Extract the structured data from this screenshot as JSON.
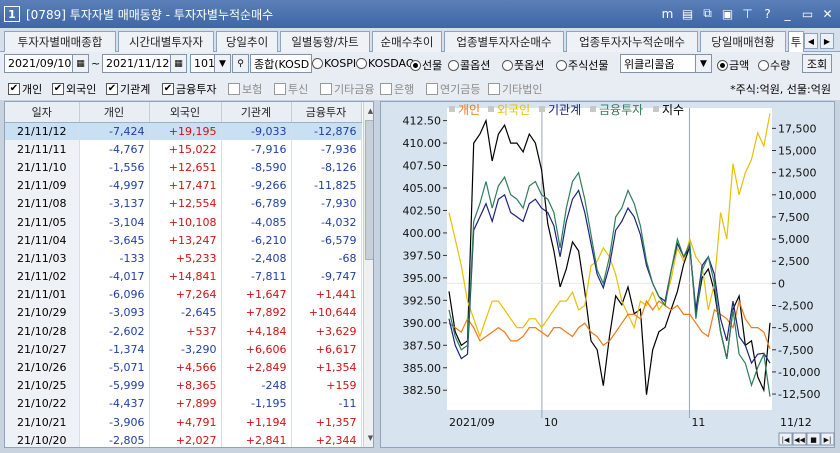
{
  "window": {
    "number": "1",
    "title": "[0789] 투자자별 매매동향 - 투자자별누적순매수",
    "icons": [
      "m-icon",
      "save-icon",
      "copy-icon",
      "window-icon",
      "pin-icon",
      "help-icon",
      "minimize-icon",
      "restore-icon",
      "close-icon"
    ],
    "icon_glyphs": [
      "m",
      "▤",
      "⧉",
      "▣",
      "⊤",
      "?",
      "_",
      "▭",
      "✕"
    ]
  },
  "tabs": [
    {
      "label": "투자자별매매종합",
      "active": false
    },
    {
      "label": "시간대별투자자",
      "active": false
    },
    {
      "label": "당일추이",
      "active": false
    },
    {
      "label": "일별동향/차트",
      "active": false
    },
    {
      "label": "순매수추이",
      "active": false
    },
    {
      "label": "업종별투자자순매수",
      "active": false
    },
    {
      "label": "업종투자자누적순매수",
      "active": false
    },
    {
      "label": "당일매매현황",
      "active": false
    },
    {
      "label": "투",
      "active": true
    }
  ],
  "controls": {
    "start_date": "2021/09/10",
    "tilde": "~",
    "end_date": "2021/11/12",
    "count": "101",
    "market_select": "종합(KOSD",
    "markets": [
      {
        "label": "KOSPI",
        "on": false
      },
      {
        "label": "KOSDAQ",
        "on": false
      },
      {
        "label": "선물",
        "on": true
      },
      {
        "label": "콜옵션",
        "on": false
      },
      {
        "label": "풋옵션",
        "on": false
      },
      {
        "label": "주식선물",
        "on": false
      }
    ],
    "weekly_select": "위클리콜옵",
    "units": [
      {
        "label": "금액",
        "on": true
      },
      {
        "label": "수량",
        "on": false
      }
    ],
    "query_button": "조회"
  },
  "filters": [
    {
      "label": "개인",
      "checked": true,
      "enabled": true
    },
    {
      "label": "외국인",
      "checked": true,
      "enabled": true
    },
    {
      "label": "기관계",
      "checked": true,
      "enabled": true
    },
    {
      "label": "금융투자",
      "checked": true,
      "enabled": true
    },
    {
      "label": "보험",
      "checked": false,
      "enabled": false
    },
    {
      "label": "투신",
      "checked": false,
      "enabled": false
    },
    {
      "label": "기타금융",
      "checked": false,
      "enabled": false
    },
    {
      "label": "은행",
      "checked": false,
      "enabled": false
    },
    {
      "label": "연기금등",
      "checked": false,
      "enabled": false
    },
    {
      "label": "기타법인",
      "checked": false,
      "enabled": false
    }
  ],
  "unit_note": "*주식:억원, 선물:억원",
  "table": {
    "headers": [
      "일자",
      "개인",
      "외국인",
      "기관계",
      "금융투자"
    ],
    "rows": [
      [
        "21/11/12",
        "-7,424",
        "+19,195",
        "-9,033",
        "-12,876"
      ],
      [
        "21/11/11",
        "-4,767",
        "+15,022",
        "-7,916",
        "-7,936"
      ],
      [
        "21/11/10",
        "-1,556",
        "+12,651",
        "-8,590",
        "-8,126"
      ],
      [
        "21/11/09",
        "-4,997",
        "+17,471",
        "-9,266",
        "-11,825"
      ],
      [
        "21/11/08",
        "-3,137",
        "+12,554",
        "-6,789",
        "-7,930"
      ],
      [
        "21/11/05",
        "-3,104",
        "+10,108",
        "-4,085",
        "-4,032"
      ],
      [
        "21/11/04",
        "-3,645",
        "+13,247",
        "-6,210",
        "-6,579"
      ],
      [
        "21/11/03",
        "-133",
        "+5,233",
        "-2,408",
        "-68"
      ],
      [
        "21/11/02",
        "-4,017",
        "+14,841",
        "-7,811",
        "-9,747"
      ],
      [
        "21/11/01",
        "-6,096",
        "+7,264",
        "+1,647",
        "+1,441"
      ],
      [
        "21/10/29",
        "-3,093",
        "-2,645",
        "+7,892",
        "+10,644"
      ],
      [
        "21/10/28",
        "-2,602",
        "+537",
        "+4,184",
        "+3,629"
      ],
      [
        "21/10/27",
        "-1,374",
        "-3,290",
        "+6,606",
        "+6,617"
      ],
      [
        "21/10/26",
        "-5,071",
        "+4,566",
        "+2,849",
        "+1,354"
      ],
      [
        "21/10/25",
        "-5,999",
        "+8,365",
        "-248",
        "+159"
      ],
      [
        "21/10/22",
        "-4,437",
        "+7,899",
        "-1,195",
        "-11"
      ],
      [
        "21/10/21",
        "-3,906",
        "+4,791",
        "+1,194",
        "+1,357"
      ],
      [
        "21/10/20",
        "-2,805",
        "+2,027",
        "+2,841",
        "+2,344"
      ]
    ]
  },
  "chart_data": {
    "type": "line",
    "legend": [
      {
        "name": "개인",
        "color": "#f07a1a"
      },
      {
        "name": "외국인",
        "color": "#e8c000"
      },
      {
        "name": "기관계",
        "color": "#1a237e"
      },
      {
        "name": "금융투자",
        "color": "#2e7d5b"
      },
      {
        "name": "지수",
        "color": "#000000"
      }
    ],
    "x_labels": [
      "2021/09",
      "10",
      "11",
      "11/12"
    ],
    "left_axis": {
      "ticks": [
        "412.50",
        "410.00",
        "407.50",
        "405.00",
        "402.50",
        "400.00",
        "397.50",
        "395.00",
        "392.50",
        "390.00",
        "387.50",
        "385.00",
        "382.50"
      ],
      "range": [
        380.3,
        413.9
      ]
    },
    "right_axis": {
      "ticks": [
        "17,500",
        "15,000",
        "12,500",
        "10,000",
        "7,500",
        "5,000",
        "2,500",
        "0",
        "-2,500",
        "-5,000",
        "-7,500",
        "-10,000",
        "-12,500"
      ],
      "range": [
        -14300,
        19800
      ]
    },
    "series": [
      {
        "name": "지수",
        "axis": "left",
        "color": "#000000",
        "values": [
          393.5,
          389,
          387.5,
          388,
          410,
          411,
          412.5,
          408,
          411,
          412,
          410,
          410,
          409,
          411,
          410,
          407,
          401,
          398,
          394,
          396,
          399,
          398,
          393.5,
          388,
          387,
          383,
          388.5,
          393,
          392,
          394,
          391,
          391.5,
          382,
          387,
          389,
          389.5,
          391.5,
          393.5,
          396.5,
          398.5,
          391,
          395,
          396,
          393.5,
          389,
          386,
          391.5,
          393,
          387.5,
          388,
          384,
          382.5,
          390
        ]
      },
      {
        "name": "외국인",
        "axis": "right",
        "color": "#e8c000",
        "values": [
          8000,
          5000,
          2000,
          -2000,
          -4000,
          -6000,
          -4000,
          -2000,
          -2000,
          -3000,
          -4000,
          -5000,
          -5000,
          -4000,
          -4000,
          -5000,
          -4000,
          -3000,
          -2000,
          -2000,
          -1000,
          -3000,
          -2500,
          2000,
          2500,
          4000,
          3000,
          1000,
          -2000,
          -3500,
          -5000,
          -2000,
          -2500,
          -1000,
          -3000,
          -2000,
          500,
          4000,
          2500,
          5000,
          3000,
          2000,
          -3000,
          0,
          8000,
          5000,
          13500,
          10000,
          12500,
          14000,
          17000,
          15500,
          19200
        ]
      },
      {
        "name": "개인",
        "axis": "right",
        "color": "#f07a1a",
        "values": [
          -4500,
          -5000,
          -5500,
          -4000,
          -5000,
          -6500,
          -6000,
          -5500,
          -5000,
          -5500,
          -6500,
          -6500,
          -6000,
          -5000,
          -5000,
          -5500,
          -6000,
          -5000,
          -5000,
          -5500,
          -6000,
          -5000,
          -4500,
          -5500,
          -6000,
          -7000,
          -6500,
          -5500,
          -4500,
          -3500,
          -3500,
          -4000,
          -2000,
          -3000,
          -2000,
          -2500,
          -3000,
          -2500,
          -3500,
          -3500,
          -4500,
          -5500,
          -6000,
          -3000,
          -3500,
          -4000,
          -5000,
          -2000,
          -4000,
          -5000,
          -5000,
          -5500,
          -7400
        ]
      },
      {
        "name": "기관계",
        "axis": "right",
        "color": "#1a237e",
        "values": [
          -4000,
          -7000,
          -8500,
          -8000,
          6000,
          7500,
          9000,
          7000,
          9500,
          10000,
          8000,
          7500,
          7000,
          9000,
          9500,
          8500,
          8000,
          6500,
          3000,
          7000,
          9500,
          10500,
          8000,
          4500,
          1000,
          -500,
          2000,
          6000,
          7000,
          8500,
          7500,
          5500,
          2000,
          0,
          -1500,
          -2000,
          1500,
          4500,
          3000,
          4000,
          -3000,
          2000,
          3000,
          1000,
          -4000,
          -6500,
          -2000,
          -6000,
          -7000,
          -9000,
          -8000,
          -7900,
          -9000
        ]
      },
      {
        "name": "금융투자",
        "axis": "right",
        "color": "#2e7d5b",
        "values": [
          -3000,
          -6000,
          -7500,
          -7000,
          7000,
          9000,
          11500,
          8500,
          11000,
          12000,
          10000,
          9500,
          8500,
          11000,
          11500,
          10000,
          9500,
          8000,
          4000,
          8500,
          11500,
          12500,
          9500,
          5500,
          1500,
          0,
          3000,
          7500,
          8500,
          10500,
          9000,
          6500,
          2500,
          0,
          -1500,
          -2500,
          1500,
          5000,
          3000,
          4500,
          -4000,
          1500,
          3000,
          0,
          -5500,
          -8500,
          -3000,
          -8000,
          -9000,
          -11500,
          -9500,
          -8000,
          -12800
        ]
      }
    ]
  },
  "chart_nav": [
    "|◀",
    "◀◀",
    "■",
    "▶|"
  ]
}
